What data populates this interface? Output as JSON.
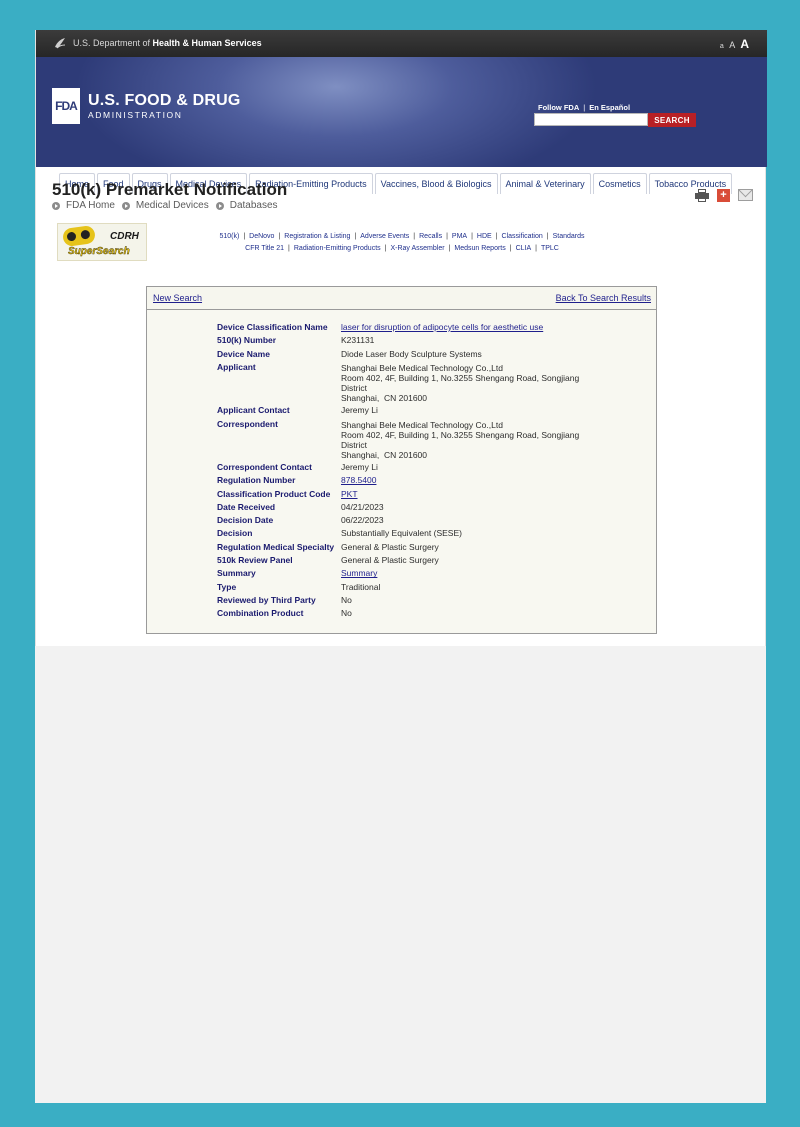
{
  "hhs_bar": {
    "prefix": "U.S. Department of ",
    "bold": "Health & Human Services",
    "text_size": [
      "a",
      "A",
      "A"
    ]
  },
  "header": {
    "logo_text": "FDA",
    "brand_name": "U.S. FOOD & DRUG",
    "brand_sub": "ADMINISTRATION",
    "follow": "Follow FDA",
    "espanol": "En Español",
    "search_label": "SEARCH",
    "search_placeholder": ""
  },
  "nav": [
    "Home",
    "Food",
    "Drugs",
    "Medical Devices",
    "Radiation-Emitting Products",
    "Vaccines, Blood & Biologics",
    "Animal & Veterinary",
    "Cosmetics",
    "Tobacco Products"
  ],
  "page": {
    "title": "510(k) Premarket Notification",
    "breadcrumb": [
      "FDA Home",
      "Medical Devices",
      "Databases"
    ]
  },
  "cdrh_logo": {
    "line1": "CDRH",
    "line2": "SuperSearch"
  },
  "db_links": {
    "row1": [
      "510(k)",
      "DeNovo",
      "Registration & Listing",
      "Adverse Events",
      "Recalls",
      "PMA",
      "HDE",
      "Classification",
      "Standards"
    ],
    "row2": [
      "CFR Title 21",
      "Radiation-Emitting Products",
      "X-Ray Assembler",
      "Medsun Reports",
      "CLIA",
      "TPLC"
    ]
  },
  "result": {
    "new_search": "New Search",
    "back": "Back To Search Results",
    "fields": {
      "device_class_name": {
        "label": "Device Classification Name",
        "value": "laser for disruption of adipocyte cells for aesthetic use"
      },
      "k_number": {
        "label": "510(k) Number",
        "value": "K231131"
      },
      "device_name": {
        "label": "Device Name",
        "value": "Diode Laser Body Sculpture Systems"
      },
      "applicant": {
        "label": "Applicant",
        "lines": [
          "Shanghai Bele Medical Technology Co.,Ltd",
          "Room 402, 4F, Building 1, No.3255 Shengang Road, Songjiang",
          "District",
          "Shanghai,  CN 201600"
        ]
      },
      "applicant_contact": {
        "label": "Applicant Contact",
        "value": "Jeremy Li"
      },
      "correspondent": {
        "label": "Correspondent",
        "lines": [
          "Shanghai Bele Medical Technology Co.,Ltd",
          "Room 402, 4F, Building 1, No.3255 Shengang Road, Songjiang",
          "District",
          "Shanghai,  CN 201600"
        ]
      },
      "correspondent_contact": {
        "label": "Correspondent Contact",
        "value": "Jeremy Li"
      },
      "regulation_number": {
        "label": "Regulation Number",
        "value": "878.5400"
      },
      "product_code": {
        "label": "Classification Product Code",
        "value": "PKT"
      },
      "date_received": {
        "label": "Date Received",
        "value": "04/21/2023"
      },
      "decision_date": {
        "label": "Decision Date",
        "value": "06/22/2023"
      },
      "decision": {
        "label": "Decision",
        "value": "Substantially Equivalent (SESE)"
      },
      "specialty": {
        "label": "Regulation Medical Specialty",
        "value": "General & Plastic Surgery"
      },
      "review_panel": {
        "label": "510k Review Panel",
        "value": "General & Plastic Surgery"
      },
      "summary": {
        "label": "Summary",
        "value": "Summary"
      },
      "type": {
        "label": "Type",
        "value": "Traditional"
      },
      "third_party": {
        "label": "Reviewed by Third Party",
        "value": "No"
      },
      "combination": {
        "label": "Combination Product",
        "value": "No"
      }
    }
  }
}
